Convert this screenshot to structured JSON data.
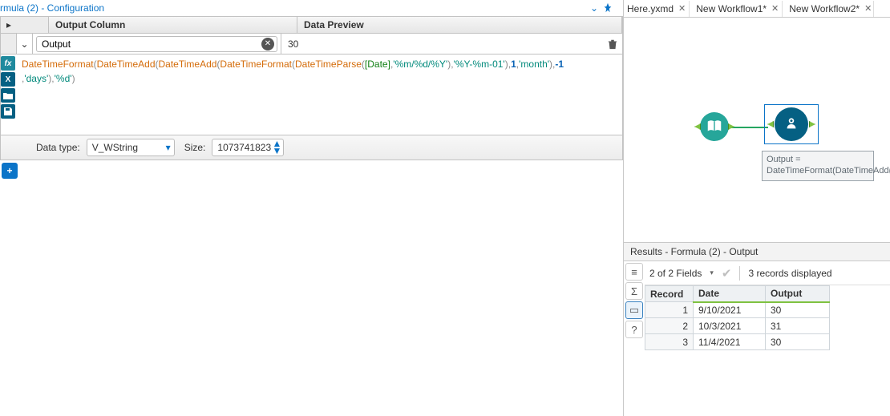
{
  "config": {
    "title_text": "rmula (2) - Configuration",
    "header_output": "Output Column",
    "header_preview": "Data Preview",
    "output_value": "Output",
    "preview_value": "30",
    "datatype_label": "Data type:",
    "datatype_value": "V_WString",
    "size_label": "Size:",
    "size_value": "1073741823",
    "expr_segments": [
      {
        "cls": "tok-fn",
        "t": "DateTimeFormat"
      },
      {
        "cls": "tok-plain",
        "t": "("
      },
      {
        "cls": "tok-fn",
        "t": "DateTimeAdd"
      },
      {
        "cls": "tok-plain",
        "t": "("
      },
      {
        "cls": "tok-fn",
        "t": "DateTimeAdd"
      },
      {
        "cls": "tok-plain",
        "t": "("
      },
      {
        "cls": "tok-fn",
        "t": "DateTimeFormat"
      },
      {
        "cls": "tok-plain",
        "t": "("
      },
      {
        "cls": "tok-fn",
        "t": "DateTimeParse"
      },
      {
        "cls": "tok-plain",
        "t": "("
      },
      {
        "cls": "tok-col",
        "t": "[Date]"
      },
      {
        "cls": "tok-plain",
        "t": ","
      },
      {
        "cls": "tok-str",
        "t": "'%m/%d/%Y'"
      },
      {
        "cls": "tok-plain",
        "t": "),"
      },
      {
        "cls": "tok-str",
        "t": "'%Y-%m-01'"
      },
      {
        "cls": "tok-plain",
        "t": "),"
      },
      {
        "cls": "tok-num",
        "t": "1"
      },
      {
        "cls": "tok-plain",
        "t": ","
      },
      {
        "cls": "tok-str",
        "t": "'month'"
      },
      {
        "cls": "tok-plain",
        "t": "),"
      },
      {
        "cls": "tok-num",
        "t": "-1"
      },
      {
        "cls": "tok-plain",
        "t": ","
      },
      {
        "cls": "tok-str",
        "t": "'days'"
      },
      {
        "cls": "tok-plain",
        "t": "),"
      },
      {
        "cls": "tok-str",
        "t": "'%d'"
      },
      {
        "cls": "tok-plain",
        "t": ")"
      }
    ]
  },
  "canvas": {
    "tabs": [
      "Here.yxmd",
      "New Workflow1*",
      "New Workflow2*"
    ],
    "annotation": "Output = DateTimeFormat(DateTimeAdd(DateTimeAdd(DateTimeFormat(DateTimeParse([Da..."
  },
  "results": {
    "title": "Results - Formula (2) - Output",
    "fields_summary": "2 of 2 Fields",
    "records_summary": "3 records displayed",
    "headers": [
      "Record",
      "Date",
      "Output"
    ],
    "rows": [
      {
        "rec": "1",
        "date": "9/10/2021",
        "out": "30"
      },
      {
        "rec": "2",
        "date": "10/3/2021",
        "out": "31"
      },
      {
        "rec": "3",
        "date": "11/4/2021",
        "out": "30"
      }
    ]
  },
  "colors": {
    "accent": "#0b74c8",
    "teal": "#056083",
    "green": "#26a69a"
  }
}
